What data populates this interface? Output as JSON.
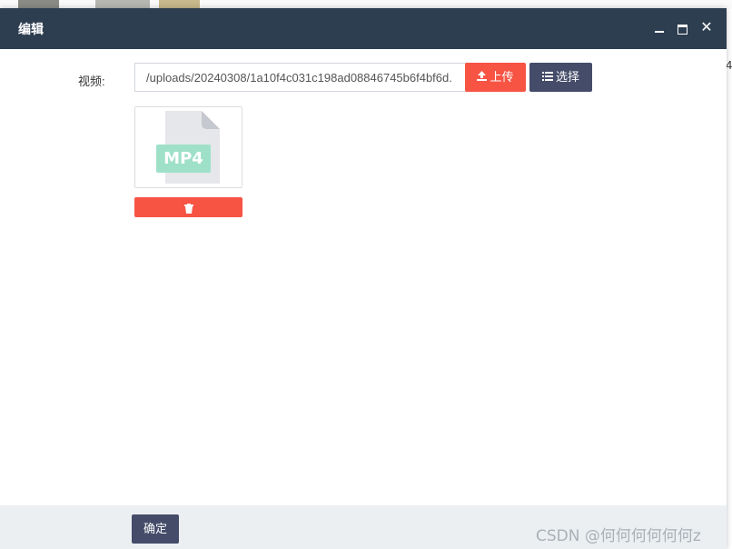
{
  "dialog": {
    "title": "编辑",
    "controls": {
      "minimize": "minimize-icon",
      "maximize": "maximize-icon",
      "close": "✕"
    }
  },
  "form": {
    "video_label": "视频:",
    "video_path": "/uploads/20240308/1a10f4c031c198ad08846745b6f4bf6d.",
    "upload_label": "上传",
    "select_label": "选择"
  },
  "preview": {
    "file_type": "MP4",
    "delete_icon": "trash-icon"
  },
  "footer": {
    "confirm_label": "确定"
  },
  "background": {
    "right_edge_text": "4"
  },
  "watermark": "CSDN @何何何何何何z",
  "colors": {
    "titlebar": "#2e3e51",
    "danger": "#f75444",
    "primary": "#444c69",
    "footer": "#eceff2",
    "file_badge": "#9fe0c9"
  }
}
